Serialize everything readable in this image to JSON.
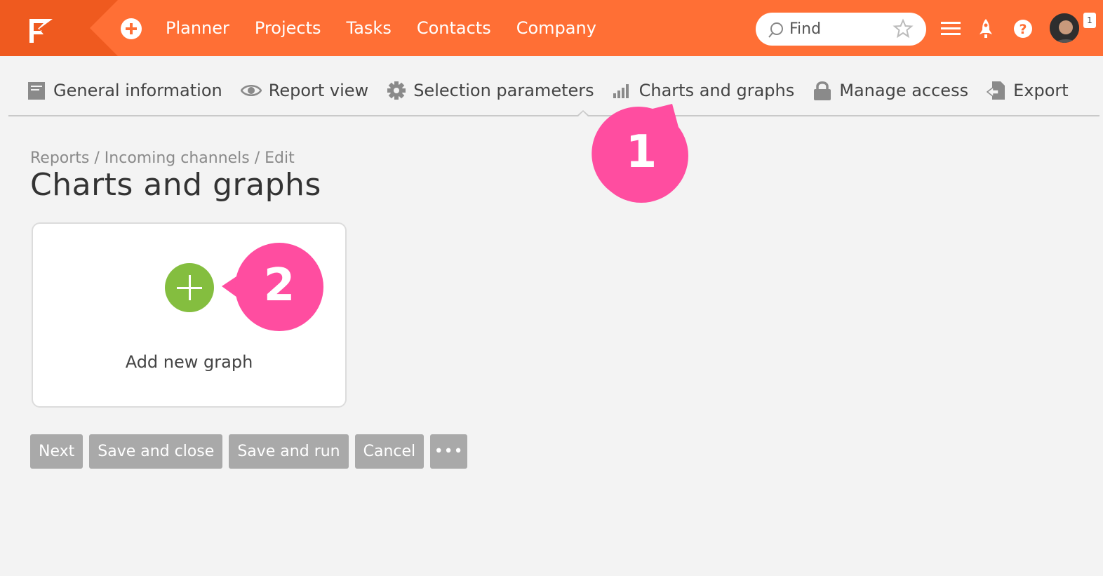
{
  "colors": {
    "topbar": "#ff6f35",
    "logo_block": "#ef5a1f",
    "add_graph_accent": "#84be3f",
    "callout": "#ff4da0",
    "button_bg": "#a9a9a9"
  },
  "topbar": {
    "logo_icon": "flag-logo-icon",
    "add_icon": "plus-circle-icon",
    "nav": [
      "Planner",
      "Projects",
      "Tasks",
      "Contacts",
      "Company"
    ],
    "search": {
      "placeholder": "Find",
      "icon": "search-icon",
      "favorite_icon": "star-icon"
    },
    "icons": [
      "menu-icon",
      "rocket-icon",
      "help-icon"
    ],
    "notification_count": "1"
  },
  "tabs": [
    {
      "label": "General information",
      "icon": "form-icon"
    },
    {
      "label": "Report view",
      "icon": "eye-icon"
    },
    {
      "label": "Selection parameters",
      "icon": "gear-icon"
    },
    {
      "label": "Charts and graphs",
      "icon": "bar-chart-icon",
      "active": true
    },
    {
      "label": "Manage access",
      "icon": "lock-icon"
    },
    {
      "label": "Export",
      "icon": "export-icon"
    }
  ],
  "breadcrumb": {
    "items": [
      "Reports",
      "Incoming channels",
      "Edit"
    ],
    "separator": " / "
  },
  "page_title": "Charts and graphs",
  "card": {
    "label": "Add new graph",
    "icon": "plus-circle-icon"
  },
  "buttons": [
    "Next",
    "Save and close",
    "Save and run",
    "Cancel",
    "•••"
  ],
  "callouts": [
    "1",
    "2"
  ]
}
